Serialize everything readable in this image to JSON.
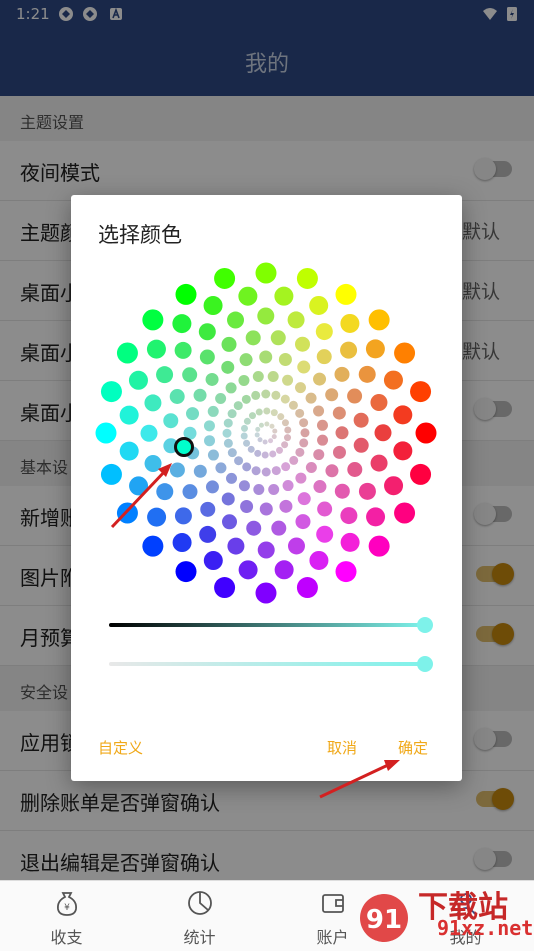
{
  "status_bar": {
    "time": "1:21"
  },
  "app_bar": {
    "title": "我的"
  },
  "settings": {
    "section_theme": "主题设置",
    "night_mode": "夜间模式",
    "theme_color": "主题颜",
    "theme_color_value": "默认",
    "desktop1": "桌面小",
    "desktop1_value": "默认",
    "desktop2": "桌面小",
    "desktop2_value": "默认",
    "desktop3": "桌面小",
    "section_basic": "基本设",
    "new_add": "新增账",
    "image": "图片附",
    "month_budget": "月预算",
    "section_security": "安全设",
    "app_lock": "应用锁",
    "delete_confirm": "删除账单是否弹窗确认",
    "exit_edit_confirm": "退出编辑是否弹窗确认"
  },
  "toggles": {
    "night_mode": false,
    "desktop3": false,
    "new_add": false,
    "image": true,
    "month_budget": true,
    "app_lock": false,
    "delete_confirm": true,
    "exit_edit_confirm": false
  },
  "bottom_nav": {
    "items": [
      "收支",
      "统计",
      "账户",
      "我的"
    ]
  },
  "dialog": {
    "title": "选择颜色",
    "custom_label": "自定义",
    "cancel_label": "取消",
    "ok_label": "确定",
    "selected_color": "#00ffcc",
    "slider_lightness": 1.0,
    "slider_alpha": 1.0
  },
  "watermark": {
    "brand": "下载站",
    "site": "91xz.net"
  }
}
